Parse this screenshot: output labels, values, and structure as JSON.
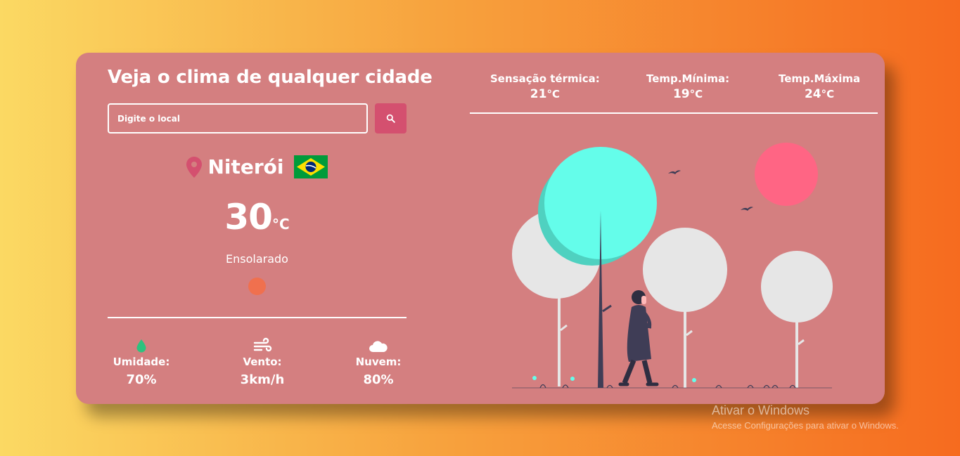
{
  "app": {
    "title": "Veja o clima de qualquer cidade"
  },
  "search": {
    "placeholder": "Digite o local",
    "value": "",
    "button_icon": "search-icon"
  },
  "location": {
    "icon": "map-pin-icon",
    "city": "Niterói",
    "flag_icon": "brazil-flag-icon"
  },
  "current": {
    "temperature": "30",
    "unit": "°C",
    "condition": "Ensolarado",
    "weather_icon": "sun-icon"
  },
  "stats": {
    "humidity": {
      "icon": "water-drop-icon",
      "label": "Umidade:",
      "value": "70%"
    },
    "wind": {
      "icon": "wind-icon",
      "label": "Vento:",
      "value": "3km/h"
    },
    "cloud": {
      "icon": "cloud-icon",
      "label": "Nuvem:",
      "value": "80%"
    }
  },
  "details": {
    "feels_like": {
      "label": "Sensação térmica:",
      "value": "21",
      "unit": "°C"
    },
    "min": {
      "label": "Temp.Mínima:",
      "value": "19",
      "unit": "°C"
    },
    "max": {
      "label": "Temp.Máxima",
      "value": "24",
      "unit": "°C"
    }
  },
  "windows_watermark": {
    "title": "Ativar o Windows",
    "subtitle": "Acesse Configurações para ativar o Windows."
  },
  "colors": {
    "card": "#d47f80",
    "accent": "#d4506f",
    "sun": "#f0704e",
    "tree_cyan": "#64fdea",
    "tree_light": "#e6e6e6",
    "illustration_sun": "#ff6584",
    "figure": "#3f3d56"
  }
}
